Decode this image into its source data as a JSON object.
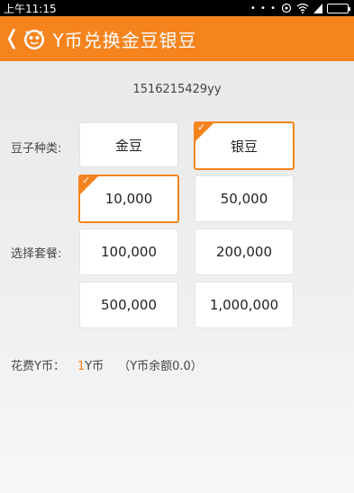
{
  "status_bar": {
    "time": "上午11:15",
    "dots": "• • •"
  },
  "header": {
    "back_symbol": "❬",
    "title": "Y币兑换金豆银豆"
  },
  "account_id": "1516215429yy",
  "bean_type": {
    "label": "豆子种类:",
    "options": [
      "金豆",
      "银豆"
    ],
    "selected_index": 1
  },
  "package": {
    "label": "选择套餐:",
    "options": [
      "10,000",
      "50,000",
      "100,000",
      "200,000",
      "500,000",
      "1,000,000"
    ],
    "selected_index": 0
  },
  "cost": {
    "label": "花费Y币：",
    "amount": "1",
    "unit": "Y币",
    "balance": "（Y币余额0.0）"
  },
  "colors": {
    "accent": "#f5841f",
    "status_bar": "#000000",
    "background": "#ededed"
  }
}
